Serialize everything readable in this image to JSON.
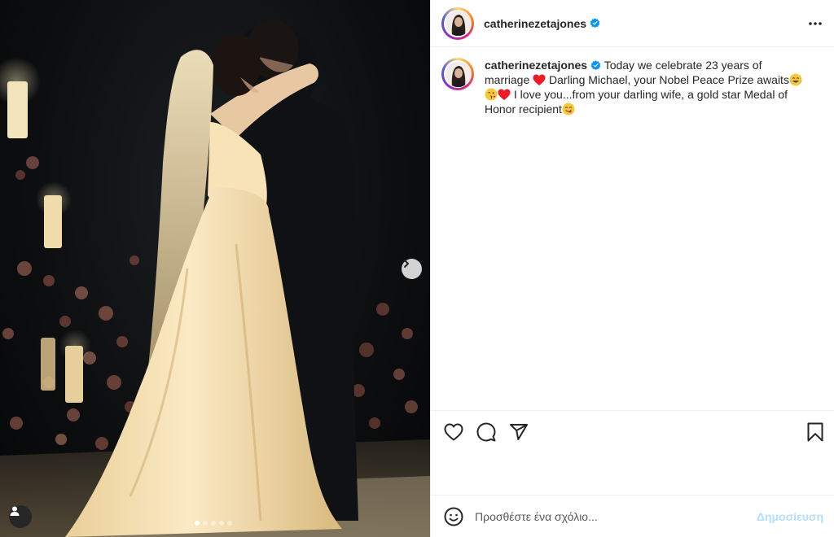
{
  "post": {
    "username": "catherinezetajones",
    "caption": {
      "part1": "Today we celebrate 23 years of marriage",
      "part2": "Darling Michael, your Nobel Peace Prize awaits",
      "part3": "I love you...from your darling wife, a gold star Medal of Honor recipient"
    },
    "carousel": {
      "slide_count": 5,
      "active_index": 0
    }
  },
  "comment": {
    "placeholder": "Προσθέστε ένα σχόλιο...",
    "post_label": "Δημοσίευση"
  },
  "colors": {
    "verified": "#0095f6",
    "heart_emoji": "#ed1c24",
    "post_button_disabled": "#b2dffc",
    "divider": "#efefef"
  },
  "icons": [
    "verified-badge-icon",
    "more-options-icon",
    "heart-icon",
    "comment-icon",
    "share-icon",
    "bookmark-icon",
    "emoji-icon",
    "chevron-right-icon",
    "user-tag-icon"
  ]
}
